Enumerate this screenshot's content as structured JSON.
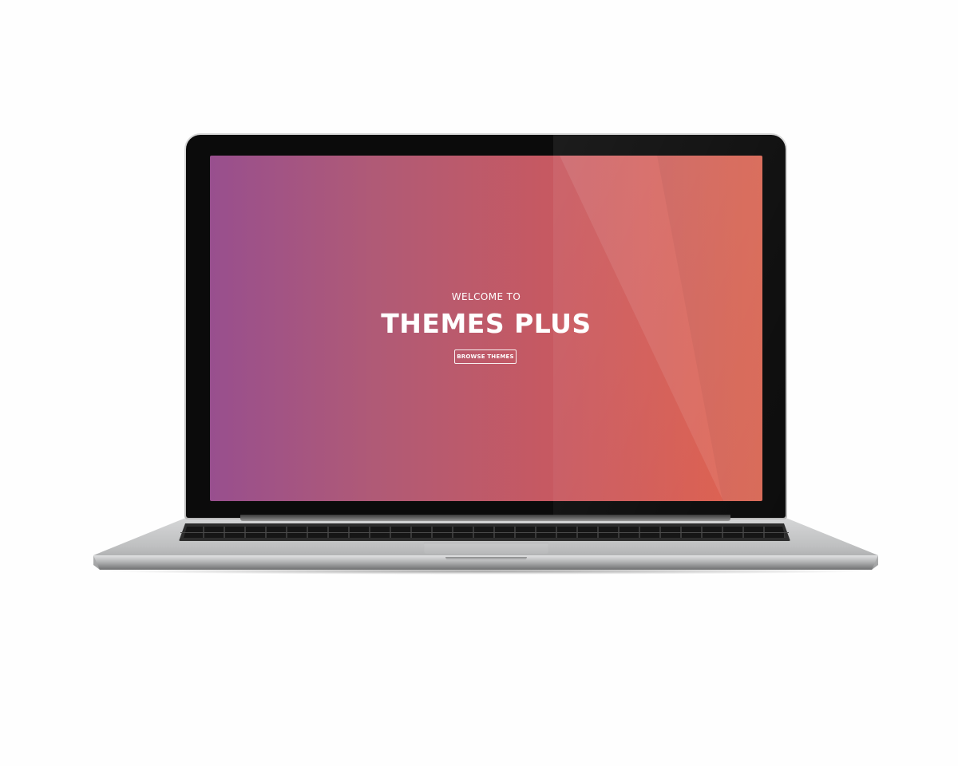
{
  "hero": {
    "eyebrow": "WELCOME TO",
    "title": "THEMES PLUS",
    "cta_label": "BROWSE THEMES"
  },
  "colors": {
    "gradient_start": "#984f8e",
    "gradient_end": "#e0614c",
    "text": "#ffffff",
    "bezel": "#0b0b0b"
  }
}
